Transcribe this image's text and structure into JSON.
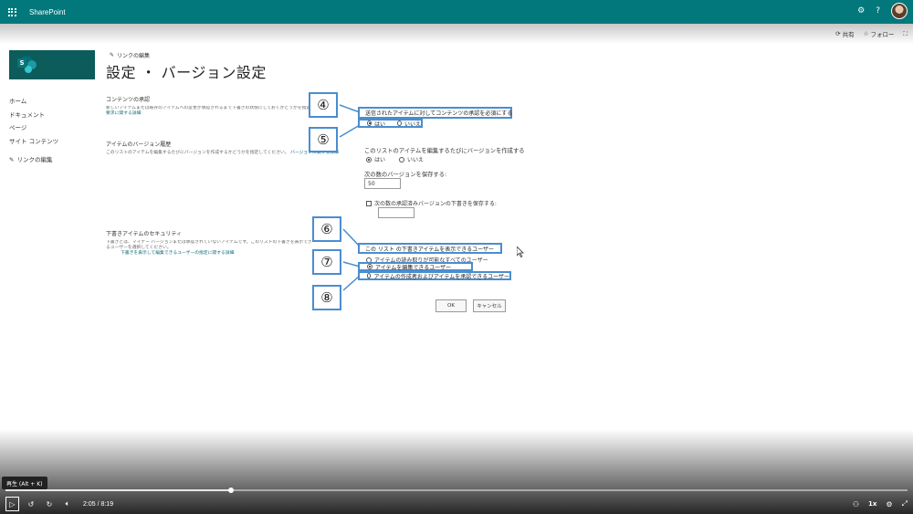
{
  "suitebar": {
    "brand": "SharePoint",
    "bg_color": "#03787c"
  },
  "commandbar": {
    "share_label": "共有",
    "follow_label": "フォロー"
  },
  "nav": {
    "items": [
      "ホーム",
      "ドキュメント",
      "ページ",
      "サイト コンテンツ"
    ],
    "edit_links": "リンクの編集"
  },
  "header": {
    "edit_links": "リンクの編集",
    "title": "設定 ・ バージョン設定"
  },
  "content_approval": {
    "title": "コンテンツの承認",
    "desc_line1": "新しいアイテムまたは既存のアイテムへの変更が承認されるまで下書きの状態にしておくかどうかを指定します。",
    "desc_link": "要求に関する詳細",
    "question": "送信されたアイテムに対してコンテンツの承認を必須にする",
    "yes": "はい",
    "no": "いいえ"
  },
  "version_history": {
    "title": "アイテムのバージョン履歴",
    "desc": "このリストのアイテムを編集するたびにバージョンを作成するかどうかを指定してください。",
    "desc_link": "バージョンに関する詳細",
    "question": "このリストのアイテムを編集するたびにバージョンを作成する",
    "yes": "はい",
    "no": "いいえ",
    "keep_label": "次の数のバージョンを保存する:",
    "keep_value": "50",
    "draft_label": "次の数の承認済みバージョンの下書きを保存する:"
  },
  "draft_security": {
    "title": "下書きアイテムのセキュリティ",
    "desc_line1": "下書きとは、マイナー バージョンまたは承認されていないアイテムです。このリストの下書きを表示できるユーザーを選択してください。",
    "desc_link": "下書きを表示して編集できるユーザーの指定に関する詳細",
    "question": "この リスト の下書きアイテムを表示できるユーザー",
    "opt_read": "アイテムの読み取りが可能なすべてのユーザー",
    "opt_edit": "アイテムを編集できるユーザー",
    "opt_approve": "アイテムの作成者およびアイテムを承認できるユーザー"
  },
  "buttons": {
    "ok": "OK",
    "cancel": "キャンセル"
  },
  "annotations": {
    "n4": "④",
    "n5": "⑤",
    "n6": "⑥",
    "n7": "⑦",
    "n8": "⑧",
    "color": "#4a8dd0"
  },
  "player": {
    "tooltip": "再生 (Alt + K)",
    "time": "2:05 / 8:19",
    "progress": 0.25,
    "speed": "1x"
  }
}
